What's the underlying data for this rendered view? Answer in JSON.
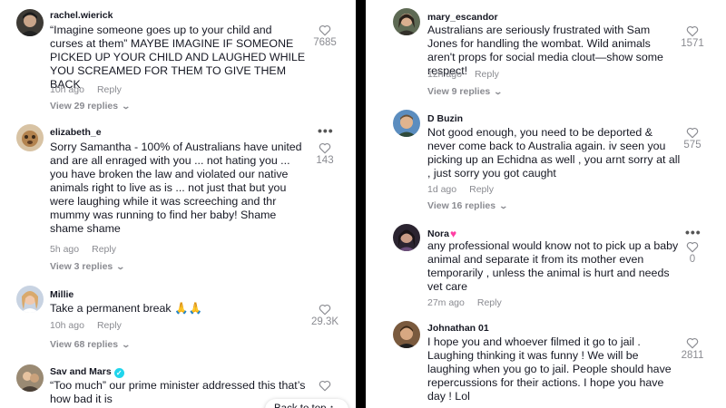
{
  "left": {
    "comments": [
      {
        "username": "rachel.wierick",
        "text": "“Imagine someone goes up to your child and curses at them” MAYBE IMAGINE IF SOMEONE PICKED UP YOUR CHILD AND LAUGHED WHILE YOU SCREAMED FOR THEM TO GIVE THEM BACK",
        "time": "10h ago",
        "reply_label": "Reply",
        "view_replies": "View 29 replies",
        "likes": "7685"
      },
      {
        "username": "elizabeth_e",
        "text": "Sorry Samantha - 100% of Australians have united and are all enraged with you ... not hating you ... you have broken the law and violated our native animals right to live as is ... not just that but you were laughing while it was screeching and thr mummy was running to find her baby! Shame shame shame",
        "time": "5h ago",
        "reply_label": "Reply",
        "view_replies": "View 3 replies",
        "likes": "143"
      },
      {
        "username": "Millie",
        "text": "Take a permanent break 🙏🙏",
        "time": "10h ago",
        "reply_label": "Reply",
        "view_replies": "View 68 replies",
        "likes": "29.3K"
      },
      {
        "username": "Sav and Mars",
        "text": "“Too much” our prime minister addressed this that’s how bad it is",
        "likes": ""
      }
    ],
    "back_to_top": "Back to top ↑"
  },
  "right": {
    "comments": [
      {
        "username": "mary_escandor",
        "text": "Australians are seriously frustrated with Sam Jones for handling the wombat. Wild animals aren't props for social media clout—show some respect!",
        "time": "12h ago",
        "reply_label": "Reply",
        "view_replies": "View 9 replies",
        "likes": "1571"
      },
      {
        "username": "D Buzin",
        "text": "Not good enough, you need to be deported & never come back to Australia again. iv seen you picking up an Echidna as well , you arnt sorry at all , just sorry you got caught",
        "time": "1d ago",
        "reply_label": "Reply",
        "view_replies": "View 16 replies",
        "likes": "575"
      },
      {
        "username": "Nora",
        "text": "any professional would know not to pick up a baby animal and separate it from its mother even temporarily , unless the animal is hurt and needs vet care",
        "time": "27m ago",
        "reply_label": "Reply",
        "likes": "0"
      },
      {
        "username": "Johnathan 01",
        "text": "I hope you and whoever filmed it go to jail . Laughing thinking it was funny ! We will be laughing when you go to jail. People should have repercussions for their actions. I hope you have day ! Lol",
        "likes": "2811"
      }
    ]
  },
  "colors": {
    "text": "#161823",
    "muted": "#8a8b91",
    "verified": "#20d5ec",
    "divider": "#000000"
  }
}
